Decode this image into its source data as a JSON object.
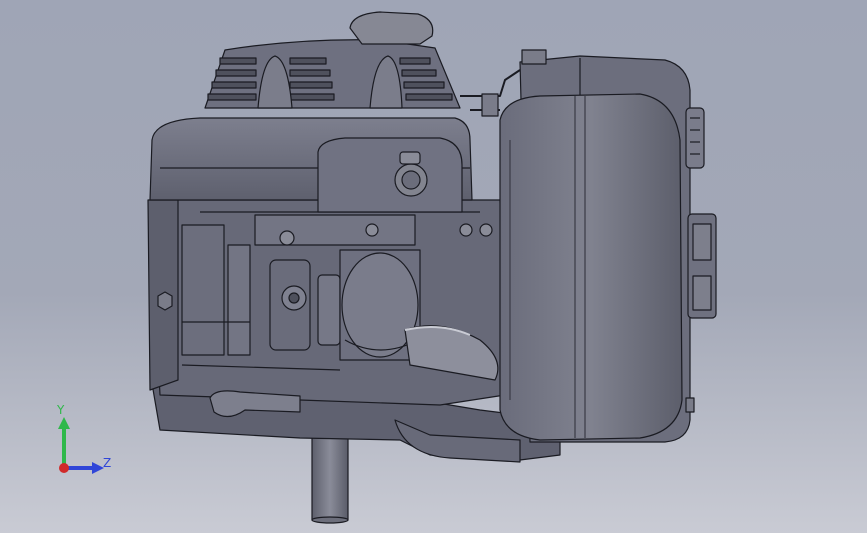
{
  "viewport": {
    "background_top": "#9fa5b6",
    "background_bottom": "#c9cbd4",
    "model_fill": "#6f7180",
    "edge_color": "#1a1b22"
  },
  "triad": {
    "y_label": "Y",
    "z_label": "Z",
    "y_color": "#2fb84a",
    "z_color": "#3046d8",
    "x_color": "#d02a2a"
  }
}
